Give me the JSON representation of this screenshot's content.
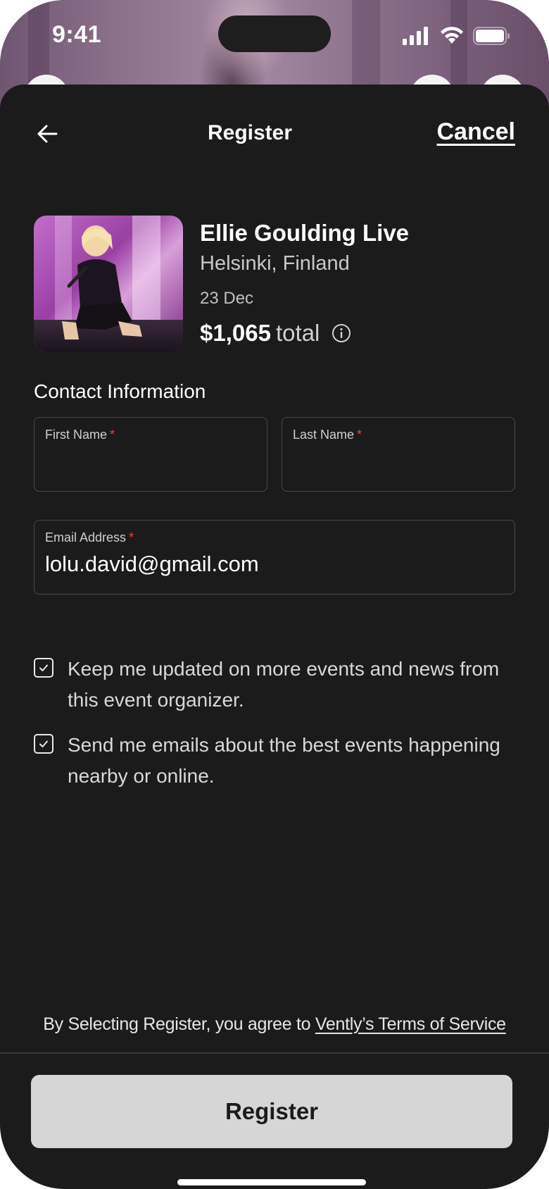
{
  "status_bar": {
    "time": "9:41",
    "icons": [
      "cellular-signal-icon",
      "wifi-icon",
      "battery-icon"
    ]
  },
  "header": {
    "title": "Register",
    "cancel_label": "Cancel",
    "back_icon": "arrow-left-icon"
  },
  "event": {
    "title": "Ellie Goulding Live",
    "location": "Helsinki, Finland",
    "date": "23 Dec",
    "price": "$1,065",
    "price_suffix": "total",
    "info_icon": "info-circle-icon"
  },
  "contact": {
    "heading": "Contact Information",
    "first_name": {
      "label": "First Name",
      "required_mark": "*",
      "value": "",
      "placeholder": ""
    },
    "last_name": {
      "label": "Last Name",
      "required_mark": "*",
      "value": "",
      "placeholder": ""
    },
    "email": {
      "label": "Email Address",
      "required_mark": "*",
      "value": "lolu.david@gmail.com"
    }
  },
  "options": [
    {
      "label": "Keep me updated on more events and news from this event organizer.",
      "checked": true
    },
    {
      "label": "Send me emails about the best events happening nearby or online.",
      "checked": true
    }
  ],
  "footer": {
    "terms_prefix": "By Selecting Register, you agree to ",
    "terms_link": "Vently’s Terms of Service",
    "register_label": "Register"
  },
  "colors": {
    "background": "#1b1b1b",
    "button": "#d6d6d6",
    "required": "#ff3b30"
  }
}
